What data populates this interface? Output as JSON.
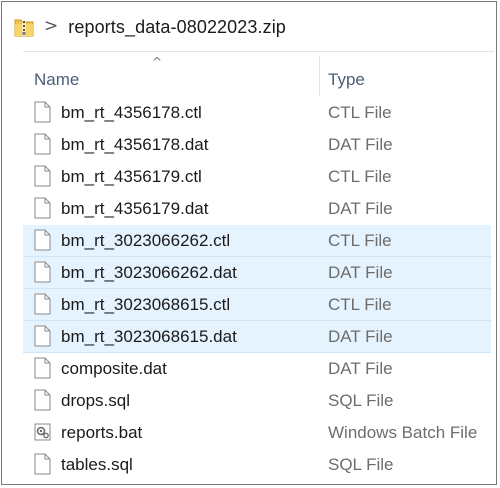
{
  "address": {
    "path": "reports_data-08022023.zip",
    "separator": ">"
  },
  "header": {
    "name_label": "Name",
    "type_label": "Type",
    "sort_indicator": "^"
  },
  "files": [
    {
      "name": "bm_rt_4356178.ctl",
      "type": "CTL File",
      "selected": false,
      "icon": "document-icon"
    },
    {
      "name": "bm_rt_4356178.dat",
      "type": "DAT File",
      "selected": false,
      "icon": "document-icon"
    },
    {
      "name": "bm_rt_4356179.ctl",
      "type": "CTL File",
      "selected": false,
      "icon": "document-icon"
    },
    {
      "name": "bm_rt_4356179.dat",
      "type": "DAT File",
      "selected": false,
      "icon": "document-icon"
    },
    {
      "name": "bm_rt_3023066262.ctl",
      "type": "CTL File",
      "selected": true,
      "icon": "document-icon"
    },
    {
      "name": "bm_rt_3023066262.dat",
      "type": "DAT File",
      "selected": true,
      "icon": "document-icon"
    },
    {
      "name": "bm_rt_3023068615.ctl",
      "type": "CTL File",
      "selected": true,
      "icon": "document-icon"
    },
    {
      "name": "bm_rt_3023068615.dat",
      "type": "DAT File",
      "selected": true,
      "icon": "document-icon"
    },
    {
      "name": "composite.dat",
      "type": "DAT File",
      "selected": false,
      "icon": "document-icon"
    },
    {
      "name": "drops.sql",
      "type": "SQL File",
      "selected": false,
      "icon": "document-icon"
    },
    {
      "name": "reports.bat",
      "type": "Windows Batch File",
      "selected": false,
      "icon": "batch-file-icon"
    },
    {
      "name": "tables.sql",
      "type": "SQL File",
      "selected": false,
      "icon": "document-icon"
    }
  ],
  "colors": {
    "selection": "#e5f3ff",
    "header_text": "#4b5d79",
    "type_text": "#6d6d6d"
  }
}
